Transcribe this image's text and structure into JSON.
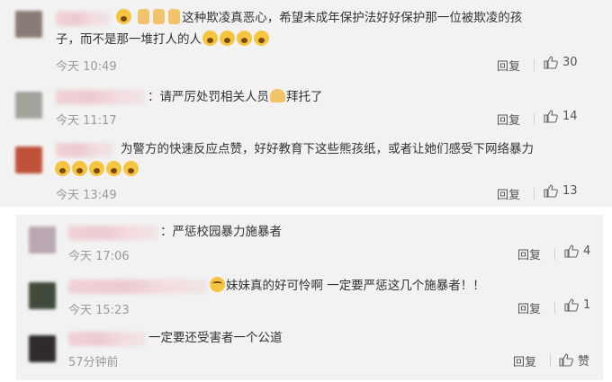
{
  "comments": [
    {
      "line1": "这种欺凌真恶心，希望未成年保护法好好保护那一位被欺凌的孩",
      "line2": "子，而不是那一堆打人的人",
      "time": "今天 10:49",
      "reply": "回复",
      "likes": "30"
    },
    {
      "line1": "：请严厉处罚相关人员",
      "line1b": "拜托了",
      "time": "今天 11:17",
      "reply": "回复",
      "likes": "14"
    },
    {
      "line1": "为警方的快速反应点赞，好好教育下这些熊孩纸，或者让她们感受下网络暴力",
      "time": "今天 13:49",
      "reply": "回复",
      "likes": "13"
    },
    {
      "line1": "：严惩校园暴力施暴者",
      "time": "今天 17:06",
      "reply": "回复",
      "likes": "4"
    },
    {
      "line1": "妹妹真的好可怜啊 一定要严惩这几个施暴者！！",
      "time": "今天 15:23",
      "reply": "回复",
      "likes": "1"
    },
    {
      "line1": "一定要还受害者一个公道",
      "time": "57分钟前",
      "reply": "回复",
      "likes": "赞"
    }
  ],
  "icons": {
    "thumb": "thumb-up-icon",
    "emoji": "face-emoji-icon"
  },
  "colors": {
    "panel": "#f2f2f2",
    "meta": "#9a9a9a"
  }
}
